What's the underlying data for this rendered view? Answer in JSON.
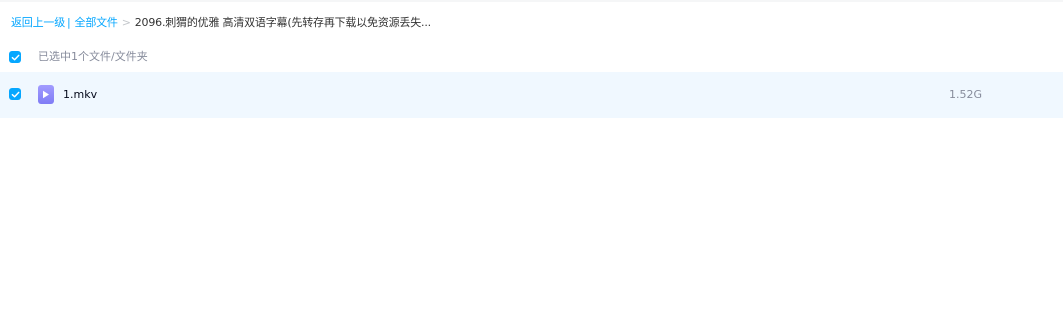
{
  "breadcrumb": {
    "back_label": "返回上一级",
    "pipe": "|",
    "root_label": "全部文件",
    "separator": ">",
    "current_label": "2096.刺猬的优雅 高清双语字幕(先转存再下载以免资源丢失..."
  },
  "selection": {
    "checked": true,
    "text": "已选中1个文件/文件夹"
  },
  "files": [
    {
      "name": "1.mkv",
      "size": "1.52G",
      "checked": true,
      "icon": "video-file-icon"
    }
  ],
  "colors": {
    "accent": "#06a7ff",
    "row_selected_bg": "#f0f8ff",
    "muted_text": "#878c9c",
    "video_icon": "#8f8afc"
  }
}
